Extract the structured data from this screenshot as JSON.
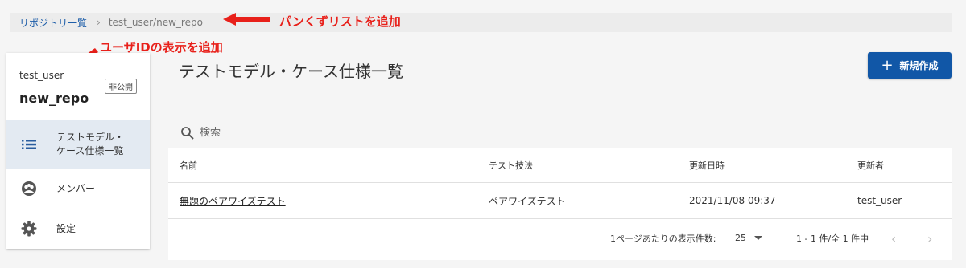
{
  "breadcrumb": {
    "root_label": "リポジトリ一覧",
    "separator": "›",
    "current": "test_user/new_repo"
  },
  "annotations": {
    "breadcrumb_note": "パンくずリストを追加",
    "userid_note": "ユーザIDの表示を追加",
    "color": "#e8201a"
  },
  "sidebar": {
    "user_id": "test_user",
    "visibility_badge": "非公開",
    "repo_name": "new_repo",
    "items": [
      {
        "icon": "list-icon",
        "label_line1": "テストモデル・",
        "label_line2": "ケース仕様一覧",
        "active": true
      },
      {
        "icon": "group-icon",
        "label_line1": "メンバー",
        "label_line2": "",
        "active": false
      },
      {
        "icon": "gear-icon",
        "label_line1": "設定",
        "label_line2": "",
        "active": false
      }
    ]
  },
  "main": {
    "title": "テストモデル・ケース仕様一覧",
    "new_button_label": "新規作成",
    "search_placeholder": "検索",
    "table": {
      "headers": [
        "名前",
        "テスト技法",
        "更新日時",
        "更新者"
      ],
      "rows": [
        [
          "無題のペアワイズテスト",
          "ペアワイズテスト",
          "2021/11/08 09:37",
          "test_user"
        ]
      ]
    },
    "pagination": {
      "rows_per_page_label": "1ページあたりの表示件数:",
      "rows_per_page_value": "25",
      "range_text": "1 - 1 件/全 1 件中",
      "prev_glyph": "‹",
      "next_glyph": "›"
    }
  },
  "colors": {
    "primary": "#1157a7",
    "link": "#1a5ba8",
    "active_nav_bg": "#e3eaf2"
  }
}
